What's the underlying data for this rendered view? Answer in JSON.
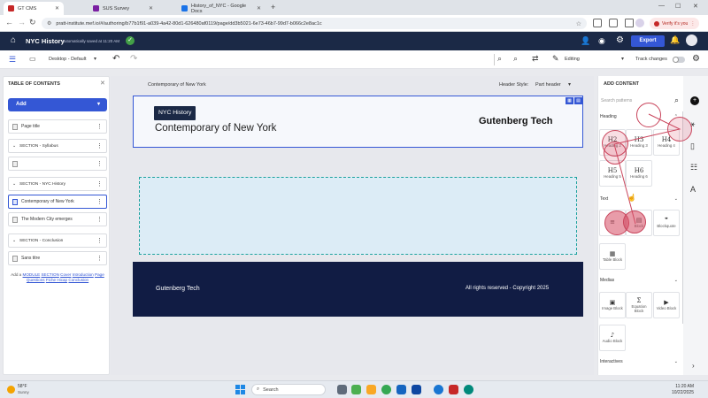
{
  "browser": {
    "tabs": [
      {
        "label": "GT CMS",
        "icon_color": "#c62828"
      },
      {
        "label": "SUS Survey",
        "icon_color": "#7b1fa2"
      },
      {
        "label": "History_of_NYC - Google Docs",
        "icon_color": "#1a73e8"
      }
    ],
    "new_tab": "+",
    "url": "pratt-institute.mef.io/#/authoring/b77b1f91-a039-4a42-80d1-626480af0119/page/dd3b5021-6e73-46b7-99d7-b066c2e8ac1c",
    "profile_label": "Verify it's you"
  },
  "app": {
    "title": "NYC History",
    "save_status": "Automatically saved at 11:20 AM",
    "export_label": "Export"
  },
  "toolbar": {
    "device": "Desktop - Default",
    "mode": "Editing",
    "track_changes": "Track changes"
  },
  "toc": {
    "title": "TABLE OF CONTENTS",
    "add_label": "Add",
    "items": [
      {
        "type": "page",
        "label": "Page title"
      },
      {
        "type": "section",
        "label": "SECTION - Syllabus"
      },
      {
        "type": "page",
        "label": ""
      },
      {
        "type": "section",
        "label": "SECTION - NYC History"
      },
      {
        "type": "page",
        "label": "Contemporary of New York"
      },
      {
        "type": "page",
        "label": "The Modern City emerges"
      },
      {
        "type": "section",
        "label": "SECTION - Conclusion"
      },
      {
        "type": "page",
        "label": "Sans titre"
      }
    ],
    "add_hint": {
      "prefix": "Add a",
      "l1": "MODULE",
      "l2": "SECTION",
      "l3": "Cover",
      "l4": "Introduction",
      "l5": "Page",
      "l6": "Questions",
      "l7": "Fiche Hicap",
      "l8": "Conclusion"
    }
  },
  "editor": {
    "page_name": "Contemporary of New York",
    "header_style_label": "Header Style:",
    "header_style_value": "Part header",
    "badge": "NYC History",
    "heading": "Contemporary of New York",
    "brand": "Gutenberg Tech",
    "footer_brand": "Gutenberg Tech",
    "footer_rights": "All rights reserved - Copyright 2025"
  },
  "panel": {
    "title": "ADD CONTENT",
    "search_placeholder": "Search patterns",
    "sections": {
      "heading": "Heading",
      "text": "Text",
      "medias": "Medias",
      "interactives": "Interactives"
    },
    "heading_blocks": [
      {
        "glyph": "H2",
        "label": "Heading 2"
      },
      {
        "glyph": "H3",
        "label": "Heading 3"
      },
      {
        "glyph": "H4",
        "label": "Heading 4"
      },
      {
        "glyph": "H5",
        "label": "Heading 5"
      },
      {
        "glyph": "H6",
        "label": "Heading 6"
      }
    ],
    "text_blocks": [
      {
        "glyph": "≡",
        "label": ""
      },
      {
        "glyph": "▤",
        "label": "Block"
      },
      {
        "glyph": "❞",
        "label": "Blockquote"
      },
      {
        "glyph": "▦",
        "label": "Table Block"
      }
    ],
    "media_blocks": [
      {
        "glyph": "▣",
        "label": "Image Block"
      },
      {
        "glyph": "Σ",
        "label": "Equation Block"
      },
      {
        "glyph": "▶",
        "label": "Video Block"
      },
      {
        "glyph": "♪",
        "label": "Audio Block"
      }
    ]
  },
  "taskbar": {
    "temp": "58°F",
    "weather": "Sunny",
    "search": "Search",
    "time": "11:20 AM",
    "date": "10/22/2025"
  },
  "colors": {
    "header": "#1b2946",
    "accent": "#3457d5",
    "footer": "#111c44",
    "overlay": "#c9455c"
  }
}
